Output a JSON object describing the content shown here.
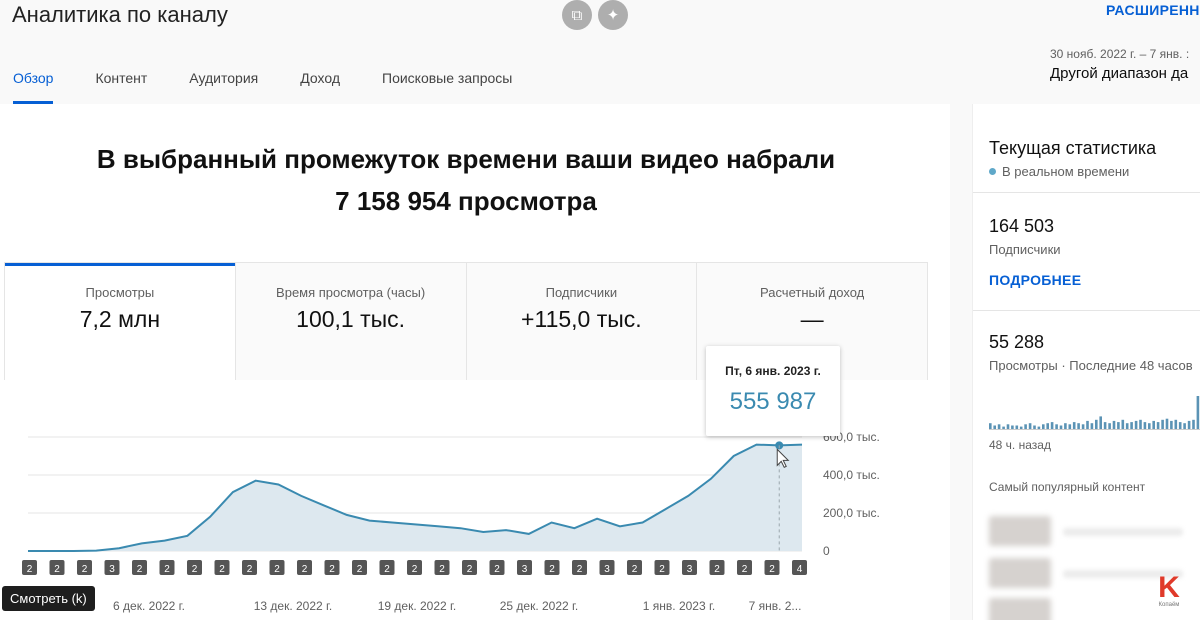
{
  "header": {
    "title": "Аналитика по каналу",
    "advanced_label": "РАСШИРЕНН",
    "date_range": "30 нояб. 2022 г. – 7 янв. :",
    "range_picker": "Другой диапазон да"
  },
  "tabs": [
    {
      "label": "Обзор",
      "active": true
    },
    {
      "label": "Контент"
    },
    {
      "label": "Аудитория"
    },
    {
      "label": "Доход"
    },
    {
      "label": "Поисковые запросы"
    }
  ],
  "headline": {
    "line1": "В выбранный промежуток времени ваши видео набрали",
    "line2": "7 158 954 просмотра"
  },
  "metrics": [
    {
      "label": "Просмотры",
      "value": "7,2 млн"
    },
    {
      "label": "Время просмотра (часы)",
      "value": "100,1 тыс."
    },
    {
      "label": "Подписчики",
      "value": "+115,0 тыс."
    },
    {
      "label": "Расчетный доход",
      "value": "—"
    }
  ],
  "tooltip": {
    "date": "Пт, 6 янв. 2023 г.",
    "value": "555 987"
  },
  "watch_button": "Смотреть (k)",
  "chart_data": {
    "type": "area",
    "series": [
      {
        "values": [
          0,
          0,
          0,
          2000,
          15000,
          40000,
          55000,
          80000,
          180000,
          310000,
          370000,
          350000,
          290000,
          240000,
          190000,
          160000,
          150000,
          140000,
          130000,
          120000,
          100000,
          110000,
          90000,
          150000,
          120000,
          170000,
          130000,
          150000,
          220000,
          290000,
          380000,
          500000,
          560000,
          556000,
          560000
        ]
      }
    ],
    "x_tick_labels": [
      "6 дек. 2022 г.",
      "13 дек. 2022 г.",
      "19 дек. 2022 г.",
      "25 дек. 2022 г.",
      "1 янв. 2023 г.",
      "7 янв. 2..."
    ],
    "y_tick_labels": [
      "0",
      "200,0 тыс.",
      "400,0 тыс.",
      "600,0 тыс."
    ],
    "ylim": [
      0,
      600000
    ],
    "highlight_index": 33,
    "grid": true,
    "color": "#3a8ab0",
    "markers": [
      "2",
      "2",
      "2",
      "3",
      "2",
      "2",
      "2",
      "2",
      "2",
      "2",
      "2",
      "2",
      "2",
      "2",
      "2",
      "2",
      "2",
      "2",
      "3",
      "2",
      "2",
      "3",
      "2",
      "2",
      "3",
      "2",
      "2",
      "2",
      "4"
    ]
  },
  "realtime": {
    "title": "Текущая статистика",
    "live_label": "В реальном времени",
    "subscribers_value": "164 503",
    "subscribers_label": "Подписчики",
    "details_link": "ПОДРОБНЕЕ",
    "views_value": "55 288",
    "views_label": "Просмотры · Последние 48 часов",
    "spark_label": "48 ч. назад",
    "popular_label": "Самый популярный контент",
    "spark_values": [
      6,
      4,
      5,
      3,
      5,
      4,
      4,
      3,
      5,
      6,
      4,
      3,
      5,
      6,
      7,
      5,
      4,
      6,
      5,
      7,
      6,
      5,
      8,
      6,
      9,
      12,
      7,
      6,
      8,
      7,
      9,
      6,
      7,
      8,
      9,
      7,
      6,
      8,
      7,
      9,
      10,
      8,
      9,
      7,
      6,
      8,
      9,
      30
    ]
  },
  "logo": {
    "letter": "K",
    "caption": "Копаём"
  }
}
